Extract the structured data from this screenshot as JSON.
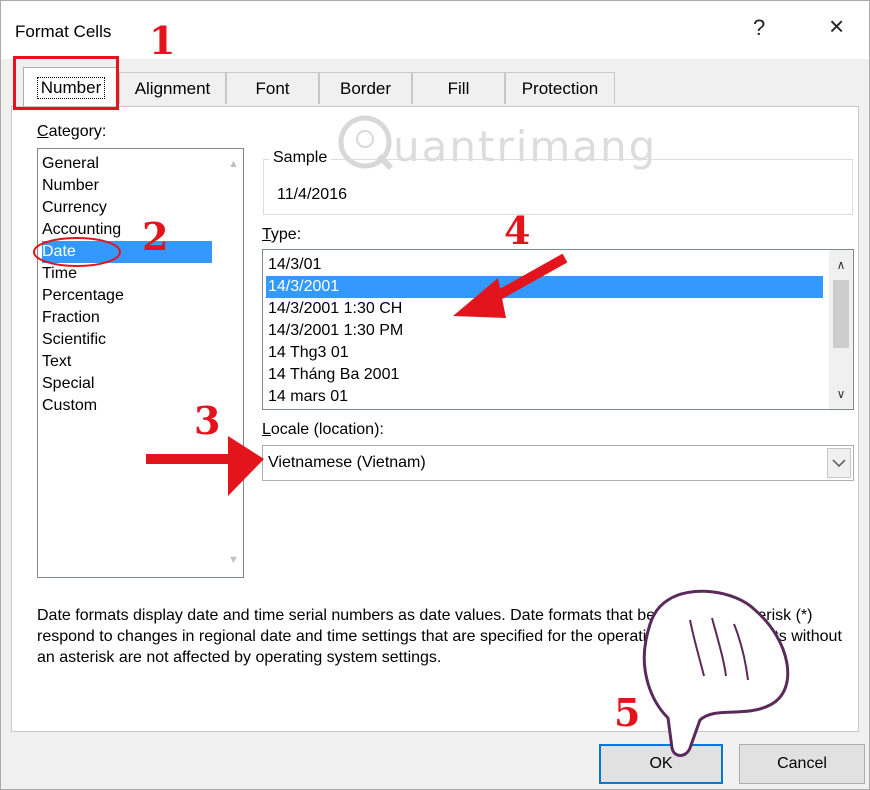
{
  "dialog": {
    "title": "Format Cells",
    "help_label": "?",
    "close_label": "×"
  },
  "tabs": [
    {
      "label": "Number"
    },
    {
      "label": "Alignment"
    },
    {
      "label": "Font"
    },
    {
      "label": "Border"
    },
    {
      "label": "Fill"
    },
    {
      "label": "Protection"
    }
  ],
  "category": {
    "label": "Category:",
    "items": [
      "General",
      "Number",
      "Currency",
      "Accounting",
      "Date",
      "Time",
      "Percentage",
      "Fraction",
      "Scientific",
      "Text",
      "Special",
      "Custom"
    ],
    "selected": "Date"
  },
  "sample": {
    "label": "Sample",
    "value": "11/4/2016"
  },
  "type": {
    "label": "Type:",
    "items": [
      "14/3/01",
      "14/3/2001",
      "14/3/2001 1:30 CH",
      "14/3/2001 1:30 PM",
      "14 Thg3 01",
      "14 Tháng Ba 2001",
      "14 mars 01"
    ],
    "selected": "14/3/2001"
  },
  "locale": {
    "label": "Locale (location):",
    "value": "Vietnamese (Vietnam)"
  },
  "description": "Date formats display date and time serial numbers as date values.  Date formats that begin with an asterisk (*) respond to changes in regional date and time settings that are specified for the operating system. Formats without an asterisk are not affected by operating system settings.",
  "buttons": {
    "ok": "OK",
    "cancel": "Cancel"
  },
  "annotations": {
    "step1": "1",
    "step2": "2",
    "step3": "3",
    "step4": "4",
    "step5": "5",
    "color": "#e3141c"
  },
  "watermark": "uantrimang",
  "colors": {
    "selection": "#3399ff",
    "default_button_border": "#0078d7",
    "annotation_red": "#e3141c"
  }
}
